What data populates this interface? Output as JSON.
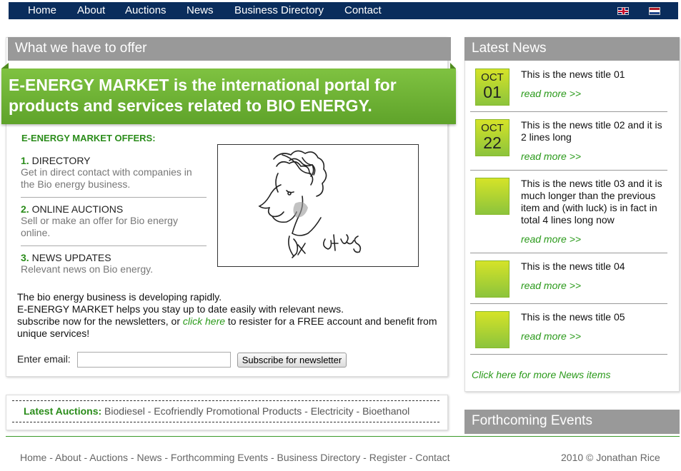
{
  "nav": {
    "items": [
      "Home",
      "About",
      "Auctions",
      "News",
      "Business Directory",
      "Contact"
    ],
    "flags": [
      "uk-flag-icon",
      "netherlands-flag-icon"
    ]
  },
  "offer": {
    "header": "What we have to offer",
    "banner": "E-ENERGY MARKET is the international portal for products and services related to BIO ENERGY.",
    "offers_title": "E-ENERGY MARKET OFFERS:",
    "items": [
      {
        "num": "1.",
        "title": "DIRECTORY",
        "desc": "Get in direct contact with companies in the Bio energy business."
      },
      {
        "num": "2.",
        "title": "ONLINE AUCTIONS",
        "desc": "Sell or make an offer for Bio energy online."
      },
      {
        "num": "3.",
        "title": "NEWS UPDATES",
        "desc": "Relevant news on Bio energy."
      }
    ],
    "intro_line1": "The bio energy business is developing rapidly.",
    "intro_line2": "E-ENERGY MARKET helps you stay up to date easily with relevant news.",
    "intro_line3_pre": "subscribe now for the newsletters, or ",
    "intro_link": "click here",
    "intro_line3_post": " to resister for a FREE account and benefit from unique services!",
    "email_label": "Enter email:",
    "email_value": "",
    "subscribe_label": "Subscribe for newsletter"
  },
  "auctions": {
    "label": "Latest Auctions:",
    "list": "Biodiesel - Ecofriendly Promotional Products - Electricity - Bioethanol"
  },
  "news": {
    "header": "Latest News",
    "items": [
      {
        "month": "OCT",
        "day": "01",
        "title": "This is the news title 01",
        "read_more": "read more >>"
      },
      {
        "month": "OCT",
        "day": "22",
        "title": "This is the news title 02 and it is 2 lines long",
        "read_more": "read more >>"
      },
      {
        "month": "",
        "day": "",
        "title": "This is the news title 03 and it is much longer than the previous item and (with luck) is in fact in total 4 lines long now",
        "read_more": "read more >>"
      },
      {
        "month": "",
        "day": "",
        "title": "This is the news title 04",
        "read_more": "read more >>"
      },
      {
        "month": "",
        "day": "",
        "title": "This is the news title 05",
        "read_more": "read more >>"
      }
    ],
    "more_link": "Click here for more News items"
  },
  "events": {
    "header": "Forthcoming Events"
  },
  "footer": {
    "links": [
      "Home",
      "About",
      "Auctions",
      "News",
      "Forthcomming Events",
      "Business Directory",
      "Register",
      "Contact"
    ],
    "copyright": "2010 © Jonathan Rice"
  },
  "colors": {
    "nav_bg": "#0a2d5c",
    "header_gray": "#999999",
    "brand_green": "#5fa32a",
    "link_green": "#2a9a1a"
  }
}
